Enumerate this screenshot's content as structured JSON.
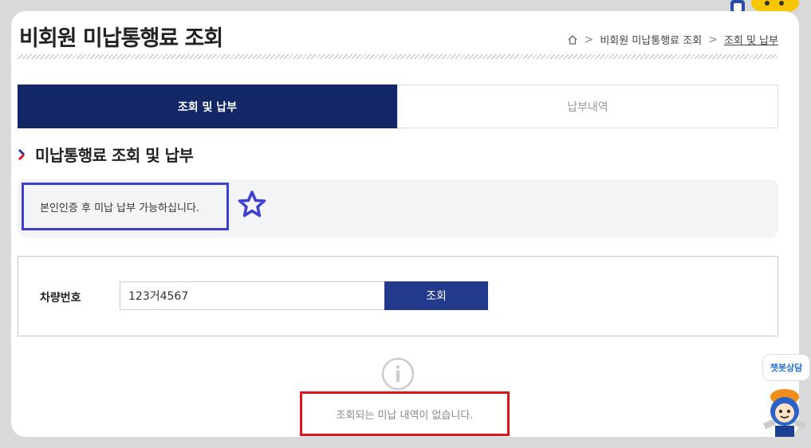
{
  "header": {
    "title": "비회원 미납통행료 조회",
    "breadcrumb": [
      "비회원 미납통행료 조회",
      "조회 및 납부"
    ]
  },
  "tabs": [
    {
      "label": "조회 및 납부",
      "active": true
    },
    {
      "label": "납부내역",
      "active": false
    }
  ],
  "section": {
    "title": "미납통행료 조회 및 납부",
    "notice": "본인인증 후 미납 납부 가능하십니다."
  },
  "search": {
    "label": "차량번호",
    "value": "123거4567",
    "button": "조회"
  },
  "result": {
    "empty_message": "조회되는 미납 내역이 없습니다."
  },
  "chatbot": {
    "label": "챗봇상담"
  },
  "colors": {
    "tab_active": "#132767",
    "button": "#233a8c",
    "highlight_blue": "#3d3fd3",
    "highlight_red": "#e2131b"
  }
}
